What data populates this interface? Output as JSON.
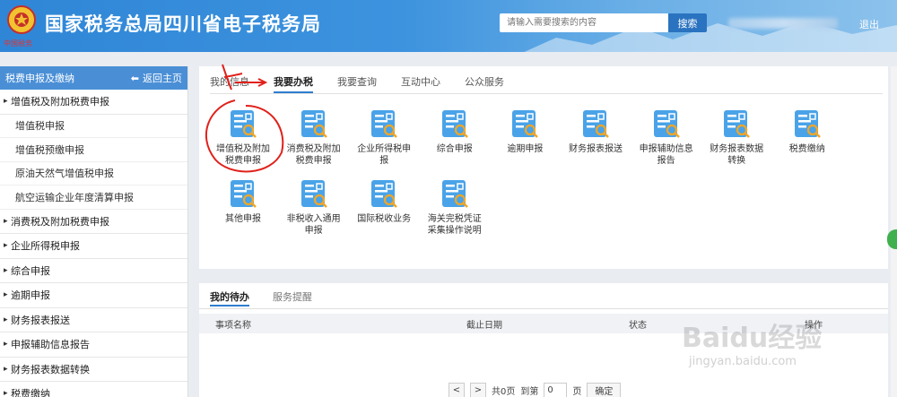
{
  "header": {
    "site_title": "国家税务总局四川省电子税务局",
    "emblem_text": "中国税务",
    "search_placeholder": "请输入需要搜索的内容",
    "search_button": "搜索",
    "logout": "退出"
  },
  "sidebar": {
    "title": "税费申报及缴纳",
    "back_home": "返回主页",
    "groups": [
      {
        "label": "增值税及附加税费申报",
        "expanded": true,
        "children": [
          "增值税申报",
          "增值税预缴申报",
          "原油天然气增值税申报",
          "航空运输企业年度清算申报"
        ]
      },
      {
        "label": "消费税及附加税费申报"
      },
      {
        "label": "企业所得税申报"
      },
      {
        "label": "综合申报"
      },
      {
        "label": "逾期申报"
      },
      {
        "label": "财务报表报送"
      },
      {
        "label": "申报辅助信息报告"
      },
      {
        "label": "财务报表数据转换"
      },
      {
        "label": "税费缴纳"
      }
    ]
  },
  "main": {
    "tabs": [
      {
        "label": "我的信息",
        "active": false
      },
      {
        "label": "我要办税",
        "active": true
      },
      {
        "label": "我要查询",
        "active": false
      },
      {
        "label": "互动中心",
        "active": false
      },
      {
        "label": "公众服务",
        "active": false
      }
    ],
    "functions": [
      {
        "label1": "增值税及附加",
        "label2": "税费申报",
        "icon": "document-search-icon"
      },
      {
        "label1": "消费税及附加",
        "label2": "税费申报",
        "icon": "document-search-icon"
      },
      {
        "label1": "企业所得税申",
        "label2": "报",
        "icon": "document-search-icon"
      },
      {
        "label1": "综合申报",
        "label2": "",
        "icon": "document-search-icon"
      },
      {
        "label1": "逾期申报",
        "label2": "",
        "icon": "document-search-icon"
      },
      {
        "label1": "财务报表报送",
        "label2": "",
        "icon": "document-search-icon"
      },
      {
        "label1": "申报辅助信息",
        "label2": "报告",
        "icon": "document-search-icon"
      },
      {
        "label1": "财务报表数据",
        "label2": "转换",
        "icon": "document-search-icon"
      },
      {
        "label1": "税费缴纳",
        "label2": "",
        "icon": "document-search-icon"
      },
      {
        "label1": "其他申报",
        "label2": "",
        "icon": "document-search-icon"
      },
      {
        "label1": "非税收入通用",
        "label2": "申报",
        "icon": "document-search-icon"
      },
      {
        "label1": "国际税收业务",
        "label2": "",
        "icon": "document-search-icon"
      },
      {
        "label1": "海关完税凭证",
        "label2": "采集操作说明",
        "icon": "document-search-icon"
      }
    ]
  },
  "todo": {
    "tabs": [
      {
        "label": "我的待办",
        "active": true
      },
      {
        "label": "服务提醒",
        "active": false
      }
    ],
    "columns": [
      "事项名称",
      "截止日期",
      "状态",
      "操作"
    ],
    "pager": {
      "prev": "<",
      "next": ">",
      "total_pages": "共0页",
      "goto": "到第",
      "page_value": "0",
      "page_unit": "页",
      "confirm": "确定"
    }
  },
  "watermark": {
    "text": "Baidu经验",
    "sub": "jingyan.baidu.com"
  },
  "colors": {
    "brand_blue": "#2f86d6",
    "tab_underline": "#2e7ed0",
    "annotation_red": "#e0211b",
    "icon_blue": "#4aa3e8",
    "icon_orange": "#f5a623"
  }
}
